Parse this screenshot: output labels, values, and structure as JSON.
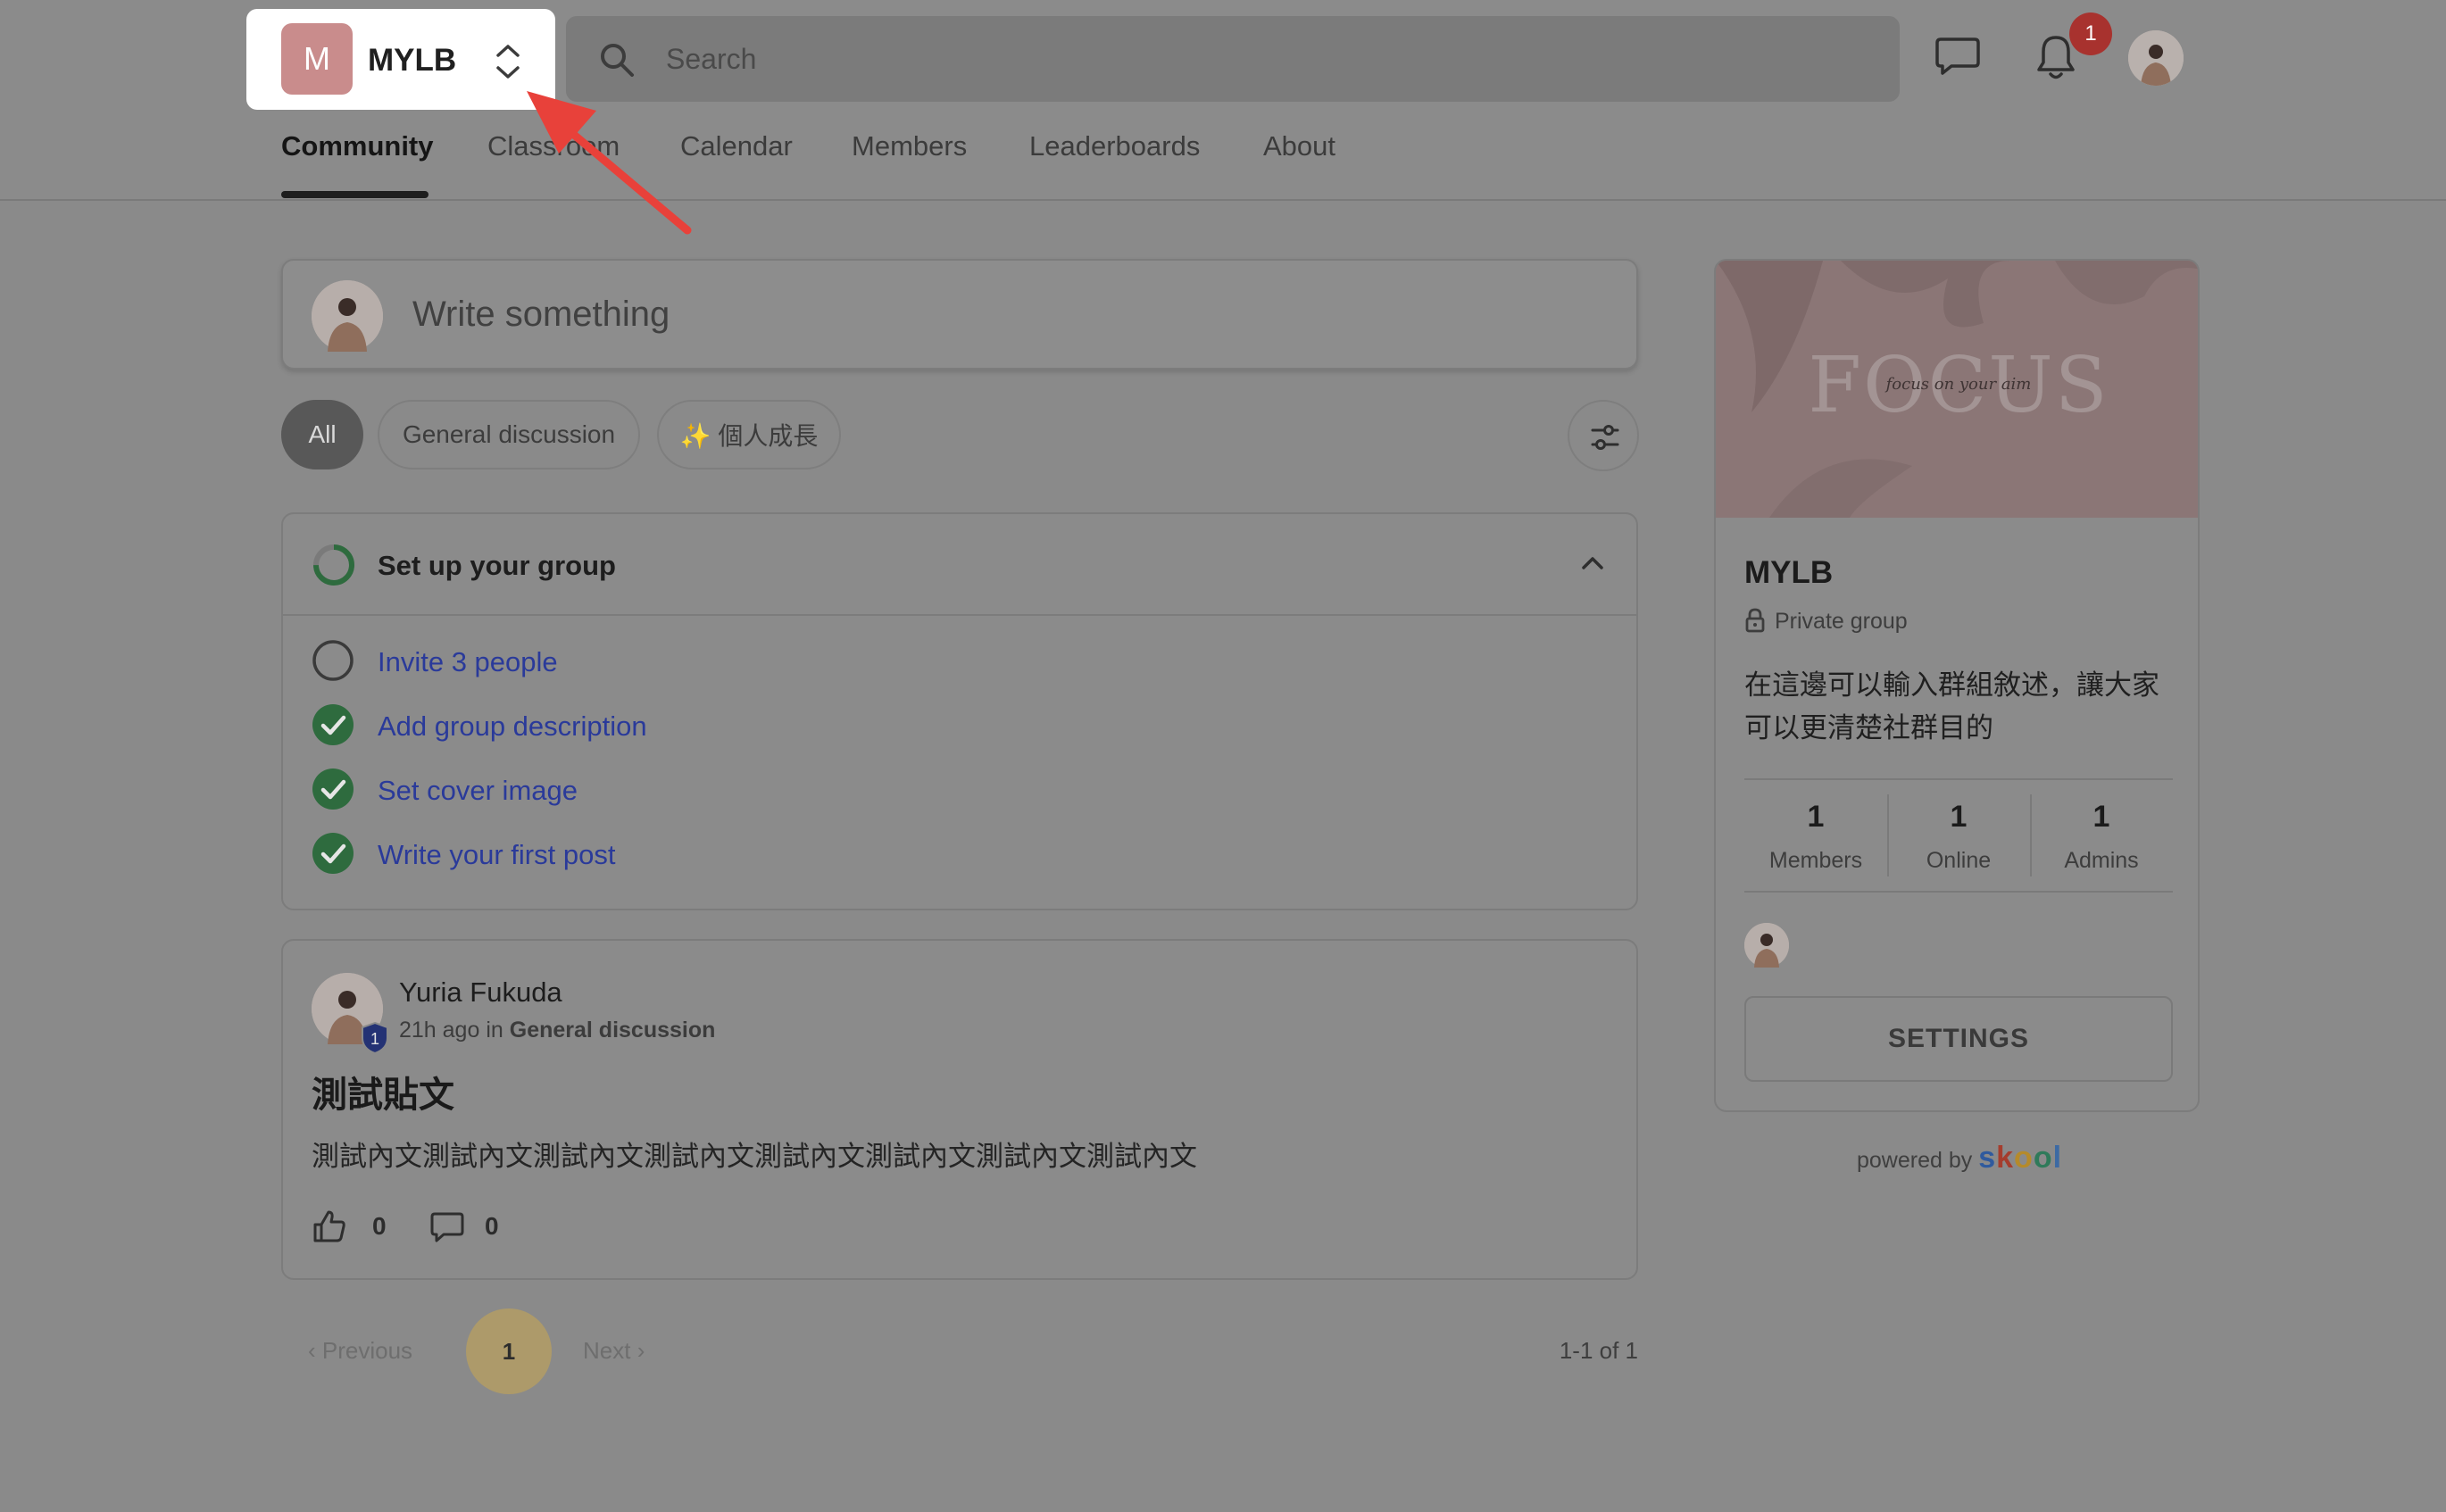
{
  "header": {
    "group": {
      "initial": "M",
      "name": "MYLB"
    },
    "search": {
      "placeholder": "Search"
    },
    "notifications": {
      "badge": "1"
    },
    "tabs": [
      {
        "label": "Community",
        "active": true
      },
      {
        "label": "Classroom"
      },
      {
        "label": "Calendar"
      },
      {
        "label": "Members"
      },
      {
        "label": "Leaderboards"
      },
      {
        "label": "About"
      }
    ]
  },
  "composer": {
    "placeholder": "Write something"
  },
  "filters": {
    "chips": [
      "All",
      "General discussion",
      "✨ 個人成長"
    ],
    "active": "All"
  },
  "setup": {
    "title": "Set up your group",
    "tasks": [
      {
        "label": "Invite 3 people",
        "done": false
      },
      {
        "label": "Add group description",
        "done": true
      },
      {
        "label": "Set cover image",
        "done": true
      },
      {
        "label": "Write your first post",
        "done": true
      }
    ]
  },
  "post": {
    "author": "Yuria Fukuda",
    "level": "1",
    "time": "21h ago",
    "in": "in",
    "category": "General discussion",
    "title": "測試貼文",
    "body": "測試內文測試內文測試內文測試內文測試內文測試內文測試內文測試內文",
    "likes": "0",
    "comments": "0"
  },
  "pagination": {
    "previous": "Previous",
    "page": "1",
    "next": "Next",
    "range": "1-1 of 1"
  },
  "sidebar": {
    "cover_word": "FOCUS",
    "cover_script": "focus on your aim",
    "name": "MYLB",
    "privacy": "Private group",
    "description": "在這邊可以輸入群組敘述，讓大家可以更清楚社群目的",
    "stats": [
      {
        "value": "1",
        "label": "Members"
      },
      {
        "value": "1",
        "label": "Online"
      },
      {
        "value": "1",
        "label": "Admins"
      }
    ],
    "settings_label": "SETTINGS",
    "powered_by": "powered by",
    "brand": "skool"
  },
  "colors": {
    "accent_check": "#2e6b3e",
    "link": "#2a3a9a",
    "arrow": "#e8413a",
    "badge": "#a8322e"
  }
}
